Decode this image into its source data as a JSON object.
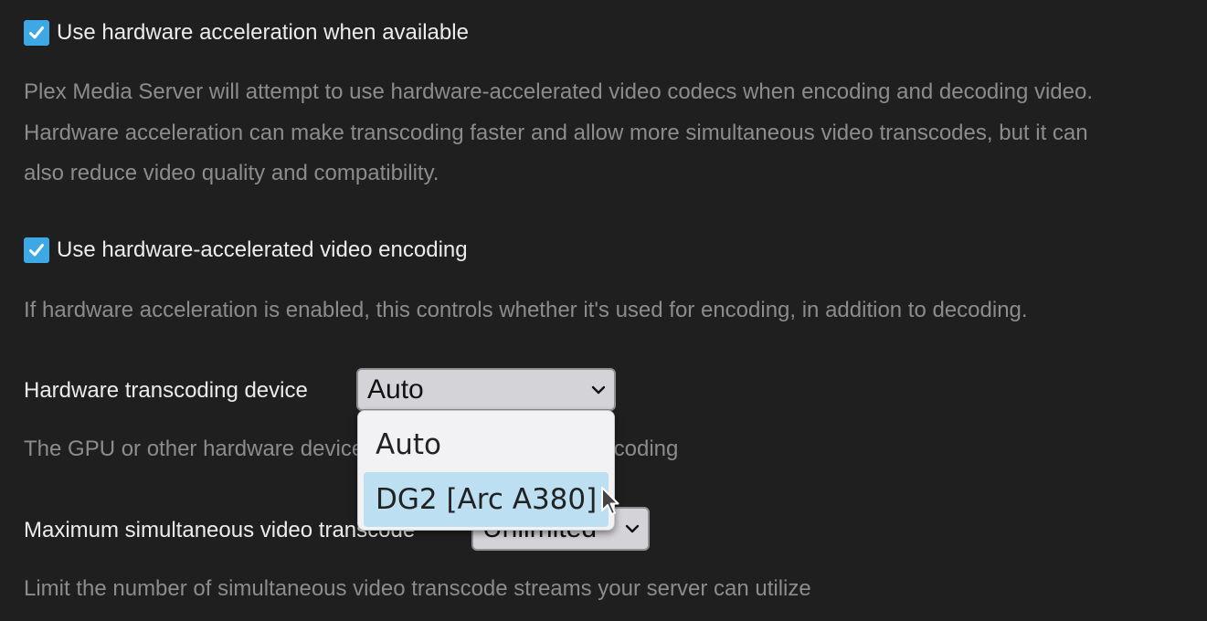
{
  "settings": {
    "hw_accel": {
      "checked": true,
      "label": "Use hardware acceleration when available",
      "description_lines": [
        "Plex Media Server will attempt to use hardware-accelerated video codecs when encoding and decoding video.",
        "Hardware acceleration can make transcoding faster and allow more simultaneous video transcodes, but it can",
        "also reduce video quality and compatibility."
      ]
    },
    "hw_encoding": {
      "checked": true,
      "label": "Use hardware-accelerated video encoding",
      "description": "If hardware acceleration is enabled, this controls whether it's used for encoding, in addition to decoding."
    },
    "transcoding_device": {
      "label": "Hardware transcoding device",
      "selected": "Auto",
      "description": "The GPU or other hardware device to use for hardware transcoding",
      "options": [
        "Auto",
        "DG2 [Arc A380]"
      ],
      "highlighted_option": "DG2 [Arc A380]"
    },
    "max_transcode": {
      "label": "Maximum simultaneous video transcode",
      "selected": "Unlimited",
      "description": "Limit the number of simultaneous video transcode streams your server can utilize"
    }
  },
  "icons": {
    "checkbox": "checkmark-icon",
    "select": "chevron-down-icon",
    "pointer": "mouse-pointer-icon"
  },
  "colors": {
    "background": "#1f1f1f",
    "checkbox_accent": "#3ea8e5",
    "option_highlight": "#bcdff2"
  }
}
